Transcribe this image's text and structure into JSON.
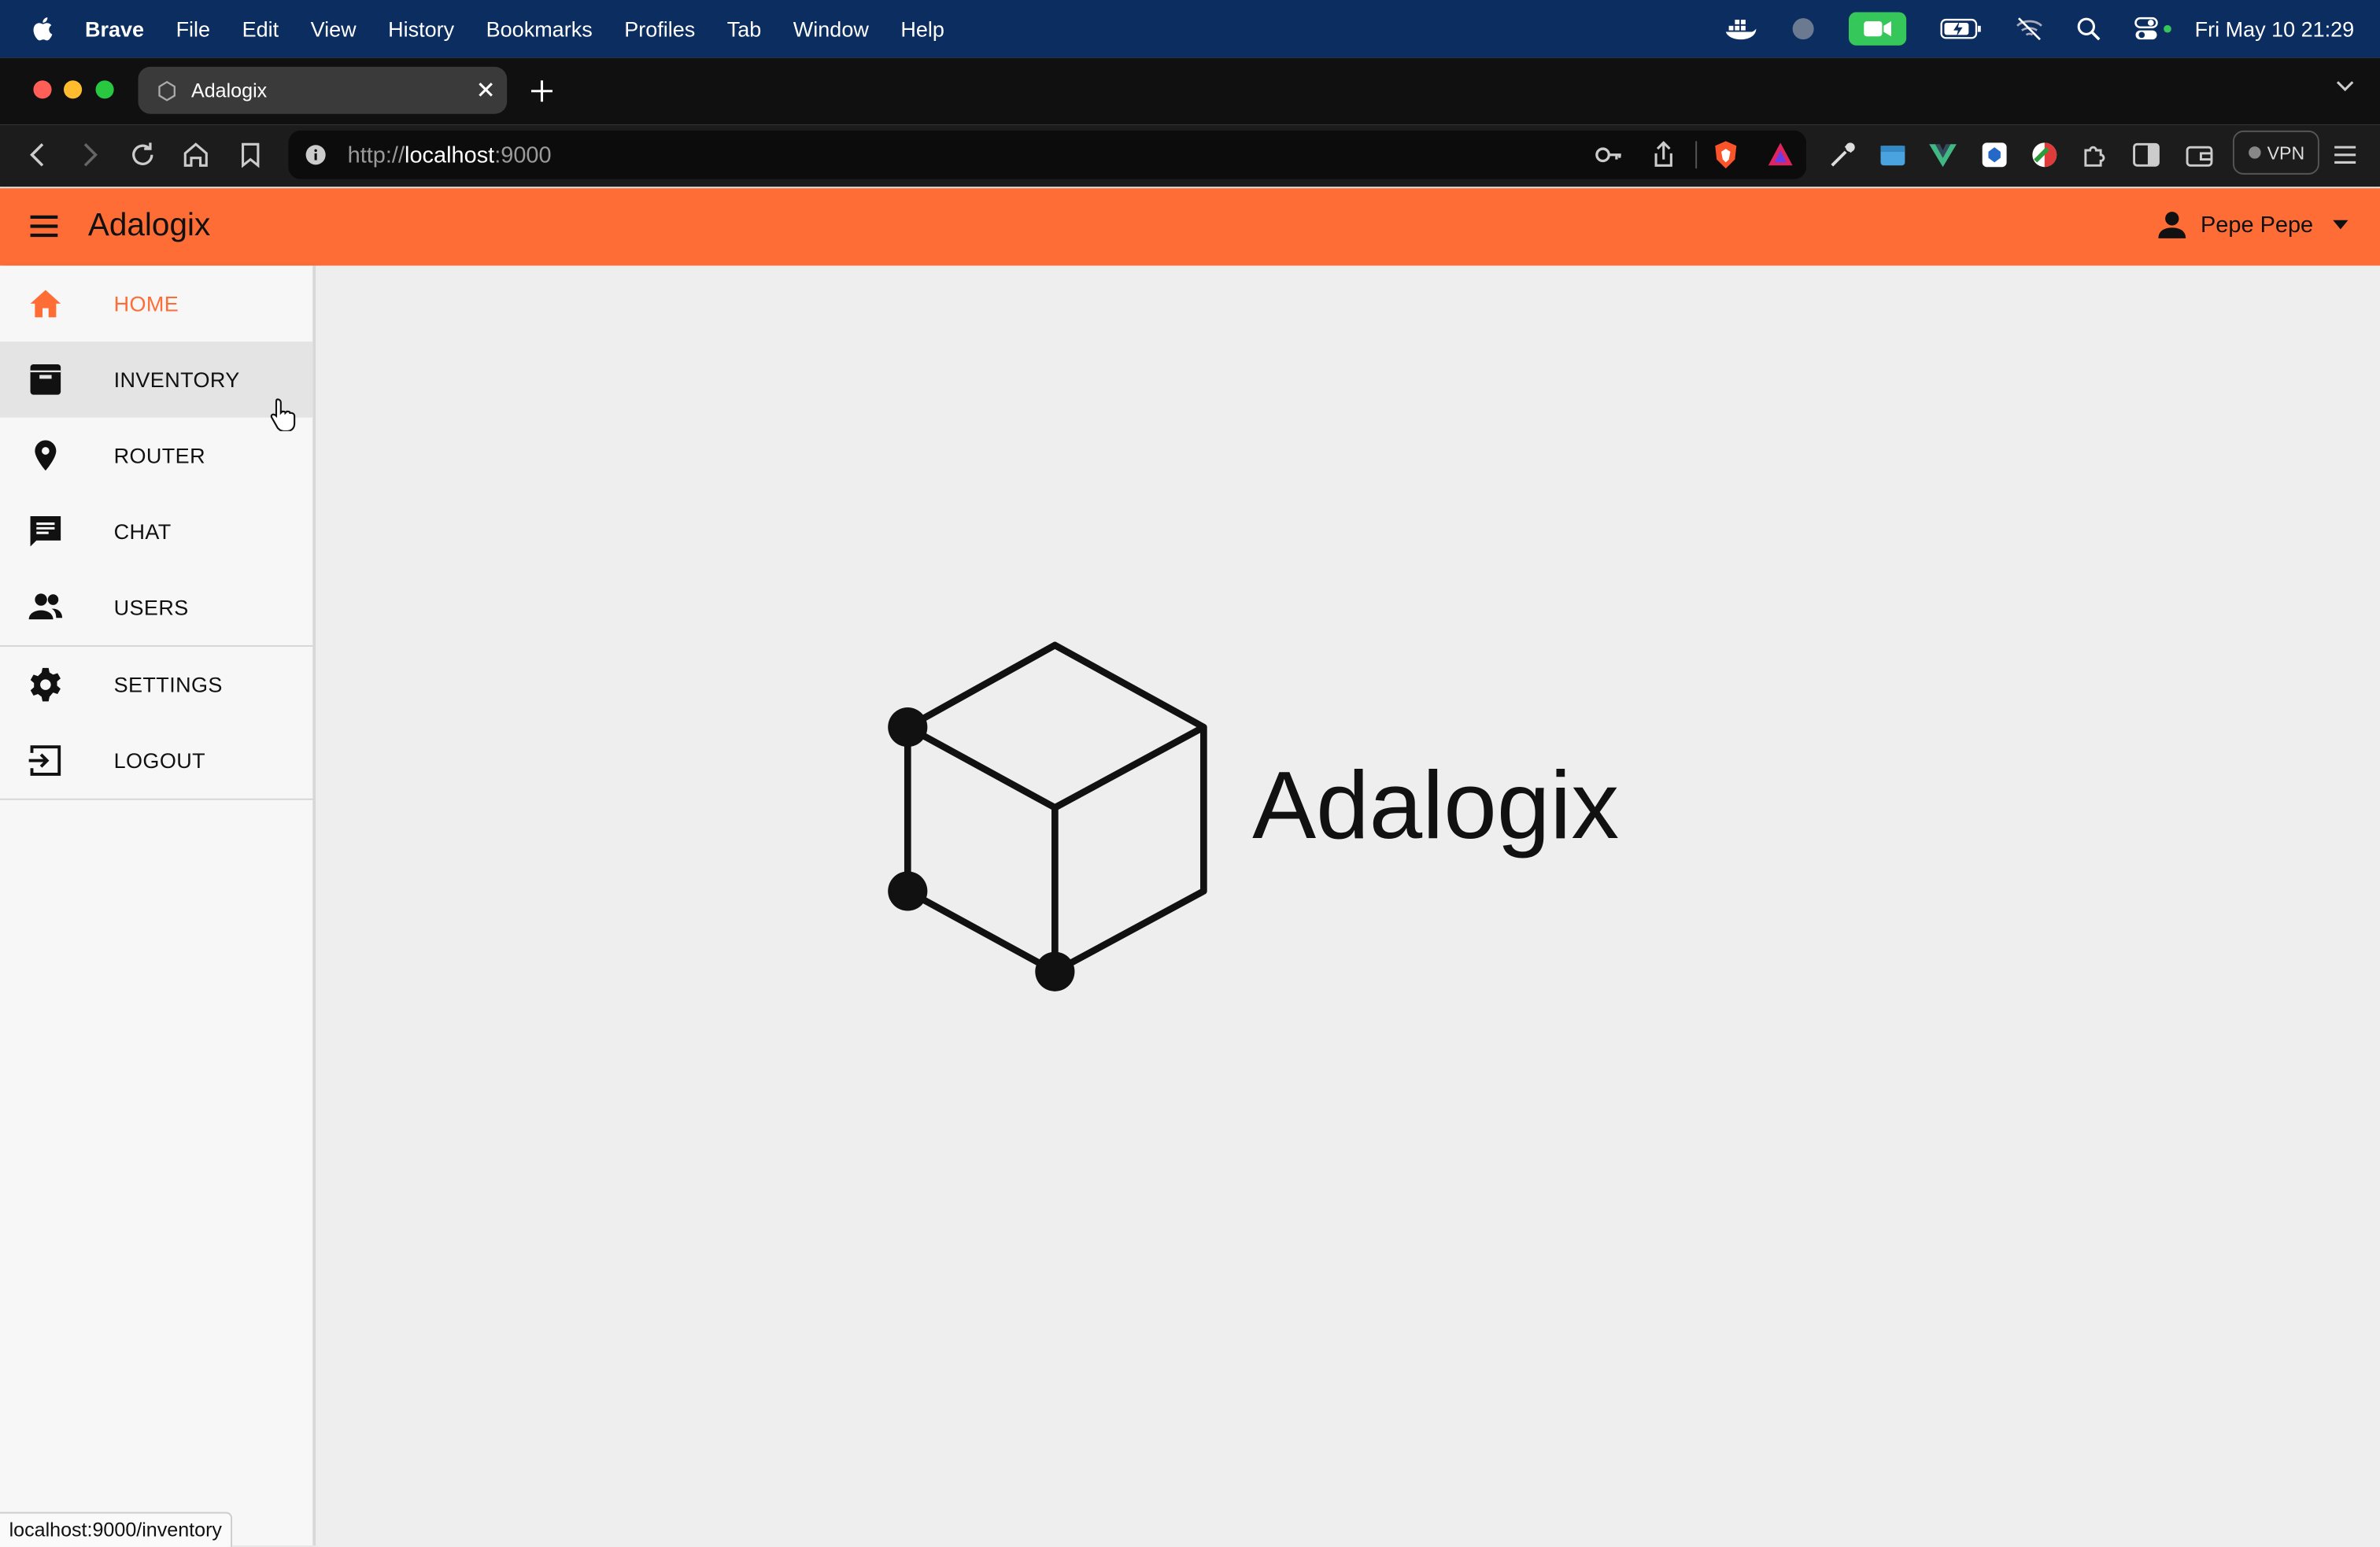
{
  "menubar": {
    "app_name": "Brave",
    "items": [
      "File",
      "Edit",
      "View",
      "History",
      "Bookmarks",
      "Profiles",
      "Tab",
      "Window",
      "Help"
    ],
    "clock": "Fri May 10  21:29",
    "status_icons": [
      "docker-icon",
      "record-icon",
      "facetime-icon",
      "battery-icon",
      "wifi-off-icon",
      "spotlight-icon",
      "control-center-icon"
    ]
  },
  "browser": {
    "tab_title": "Adalogix",
    "url_scheme": "http://",
    "url_host": "localhost",
    "url_port": ":9000",
    "vpn_label": "VPN",
    "extension_icons": [
      "key-icon",
      "share-icon",
      "brave-shield-icon",
      "brave-rewards-icon",
      "eyedropper-icon",
      "folder-icon",
      "vue-devtools-icon",
      "extension-icon",
      "color-icon",
      "puzzle-icon",
      "sidebar-icon",
      "wallet-icon",
      "menu-icon"
    ]
  },
  "appbar": {
    "title": "Adalogix",
    "user_name": "Pepe Pepe"
  },
  "sidebar": {
    "items": [
      {
        "label": "HOME",
        "icon": "home-icon",
        "active": true
      },
      {
        "label": "INVENTORY",
        "icon": "archive-icon",
        "hover": true
      },
      {
        "label": "ROUTER",
        "icon": "map-pin-icon"
      },
      {
        "label": "CHAT",
        "icon": "chat-icon"
      },
      {
        "label": "USERS",
        "icon": "users-icon"
      },
      {
        "label": "SETTINGS",
        "icon": "gear-icon"
      },
      {
        "label": "LOGOUT",
        "icon": "logout-icon"
      }
    ]
  },
  "main": {
    "logo_text": "Adalogix"
  },
  "status_bar": {
    "link": "localhost:9000/inventory"
  },
  "colors": {
    "accent": "#ff6d37",
    "menubar": "#0b2d5f",
    "background": "#eeeeee"
  }
}
